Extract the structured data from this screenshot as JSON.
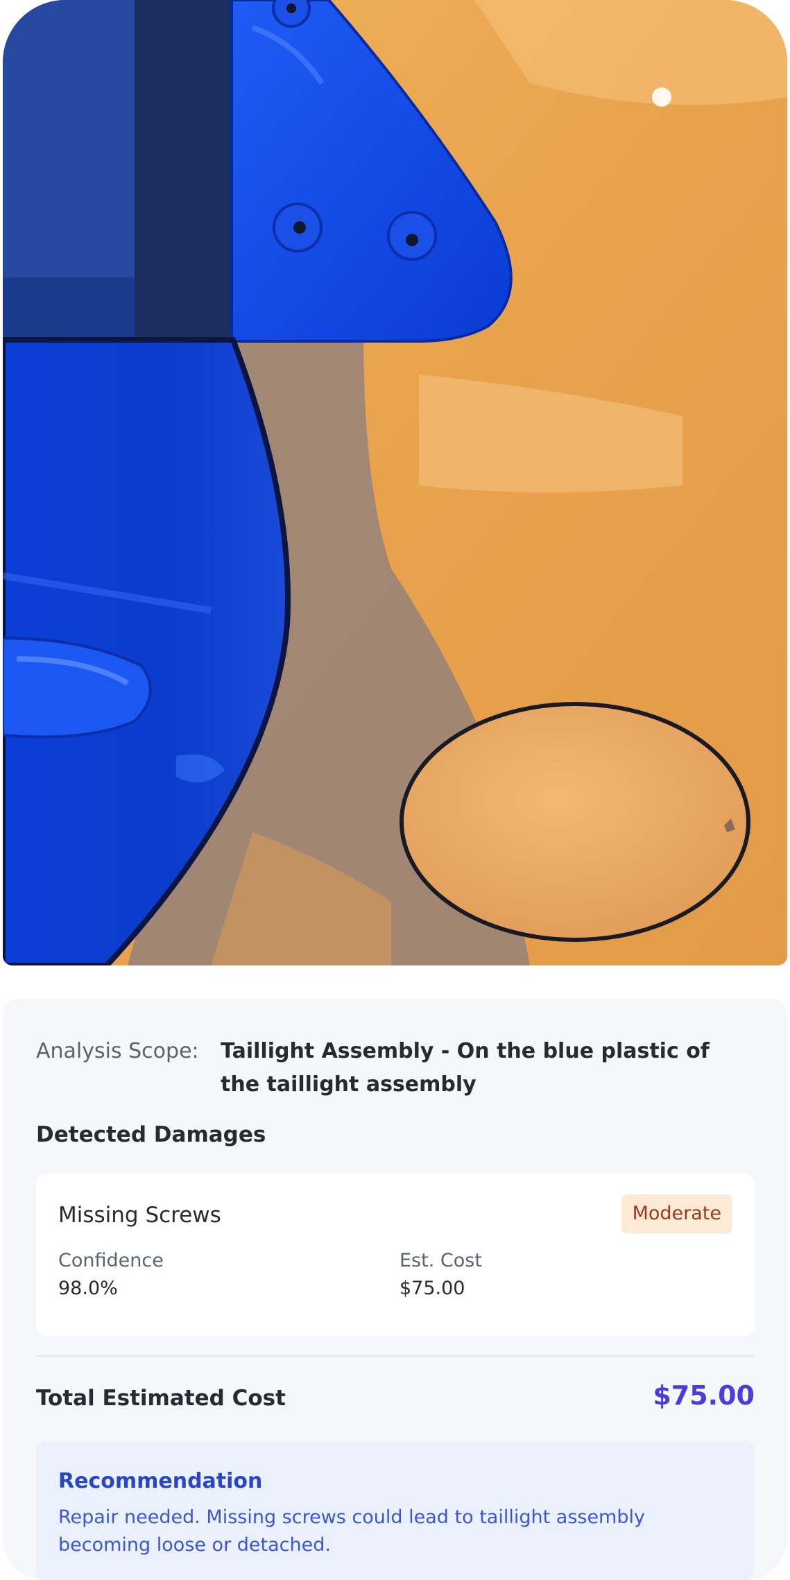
{
  "photo": {
    "subject": "car-damage-photo"
  },
  "analysis": {
    "scope_label": "Analysis Scope:",
    "scope_value": "Taillight Assembly - On the blue plastic of the taillight assembly"
  },
  "detected_damages": {
    "title": "Detected Damages",
    "items": [
      {
        "name": "Missing Screws",
        "severity": "Moderate",
        "confidence_label": "Confidence",
        "confidence_value": "98.0%",
        "cost_label": "Est. Cost",
        "cost_value": "$75.00"
      }
    ]
  },
  "total": {
    "label": "Total Estimated Cost",
    "value": "$75.00"
  },
  "recommendation": {
    "title": "Recommendation",
    "body": "Repair needed. Missing screws could lead to taillight assembly becoming loose or detached."
  },
  "colors": {
    "accent": "#4a3de0",
    "severity_bg": "#fde9d6",
    "severity_text": "#9b3a1a",
    "recommendation_bg": "#eaf1fd"
  }
}
